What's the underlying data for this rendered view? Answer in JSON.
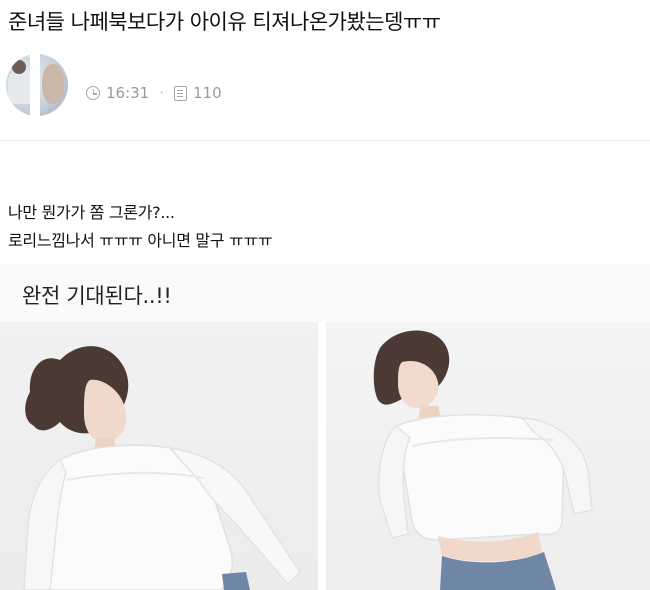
{
  "post": {
    "title": "준녀들 나페북보다가 아이유 티져나온가봤는뎅ㅠㅠ",
    "time": "16:31",
    "separator": "·",
    "views": "110"
  },
  "icons": {
    "clock": "clock-icon",
    "views": "document-icon"
  },
  "content": {
    "line1": "나만 뭔가가 쫌 그론가?...",
    "line2": "로리느낌나서 ㅠㅠㅠ 아니면 말구 ㅠㅠㅠ",
    "quote": "완전 기대된다..!!"
  },
  "colors": {
    "meta_gray": "#9a9a9a",
    "divider": "#e6e6e6"
  }
}
